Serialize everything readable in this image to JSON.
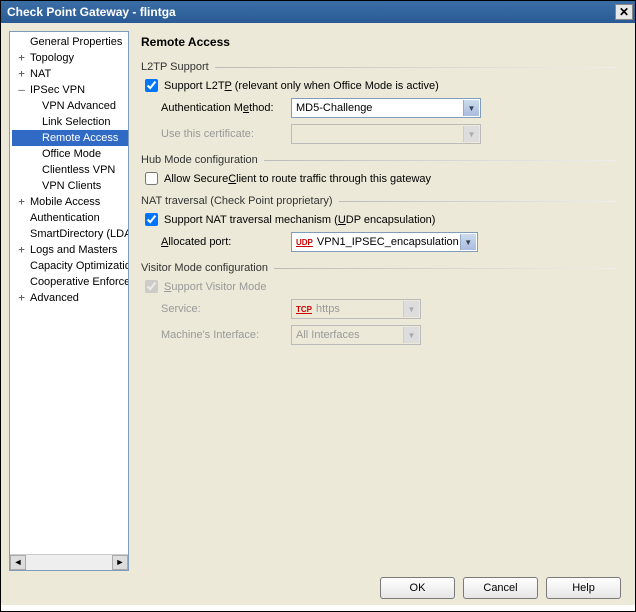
{
  "window": {
    "title": "Check Point Gateway - flintga"
  },
  "tree": {
    "items": [
      {
        "label": "General Properties",
        "indent": 0,
        "exp": ""
      },
      {
        "label": "Topology",
        "indent": 0,
        "exp": "+"
      },
      {
        "label": "NAT",
        "indent": 0,
        "exp": "+"
      },
      {
        "label": "IPSec VPN",
        "indent": 0,
        "exp": "–"
      },
      {
        "label": "VPN Advanced",
        "indent": 1,
        "exp": ""
      },
      {
        "label": "Link Selection",
        "indent": 1,
        "exp": ""
      },
      {
        "label": "Remote Access",
        "indent": 1,
        "exp": "",
        "selected": true
      },
      {
        "label": "Office Mode",
        "indent": 1,
        "exp": ""
      },
      {
        "label": "Clientless VPN",
        "indent": 1,
        "exp": ""
      },
      {
        "label": "VPN Clients",
        "indent": 1,
        "exp": ""
      },
      {
        "label": "Mobile Access",
        "indent": 0,
        "exp": "+"
      },
      {
        "label": "Authentication",
        "indent": 0,
        "exp": ""
      },
      {
        "label": "SmartDirectory (LDAP)",
        "indent": 0,
        "exp": ""
      },
      {
        "label": "Logs and Masters",
        "indent": 0,
        "exp": "+"
      },
      {
        "label": "Capacity Optimization",
        "indent": 0,
        "exp": ""
      },
      {
        "label": "Cooperative Enforcement",
        "indent": 0,
        "exp": ""
      },
      {
        "label": "Advanced",
        "indent": 0,
        "exp": "+"
      }
    ]
  },
  "page": {
    "title": "Remote Access",
    "l2tp": {
      "section": "L2TP Support",
      "support_label_pre": "Support L2T",
      "support_label_u": "P",
      "support_label_post": " (relevant only when Office Mode is active)",
      "support_checked": true,
      "auth_label_pre": "Authentication M",
      "auth_label_u": "e",
      "auth_label_post": "thod:",
      "auth_value": "MD5-Challenge",
      "cert_label": "Use this certificate:",
      "cert_value": ""
    },
    "hub": {
      "section": "Hub Mode configuration",
      "allow_label_pre": "Allow Secure",
      "allow_label_u": "C",
      "allow_label_post": "lient to route traffic through this gateway",
      "allow_checked": false
    },
    "nat": {
      "section": "NAT traversal (Check Point proprietary)",
      "support_label_pre": "Support NAT traversal mechanism (",
      "support_label_u": "U",
      "support_label_post": "DP encapsulation)",
      "support_checked": true,
      "port_label_u": "A",
      "port_label_post": "llocated port:",
      "port_proto": "UDP",
      "port_value": "VPN1_IPSEC_encapsulation"
    },
    "visitor": {
      "section": "Visitor Mode configuration",
      "support_label_u": "S",
      "support_label_post": "upport Visitor Mode",
      "support_checked": true,
      "service_label": "Service:",
      "service_proto": "TCP",
      "service_value": "https",
      "iface_label": "Machine's Interface:",
      "iface_value": "All Interfaces"
    }
  },
  "buttons": {
    "ok": "OK",
    "cancel": "Cancel",
    "help": "Help"
  }
}
